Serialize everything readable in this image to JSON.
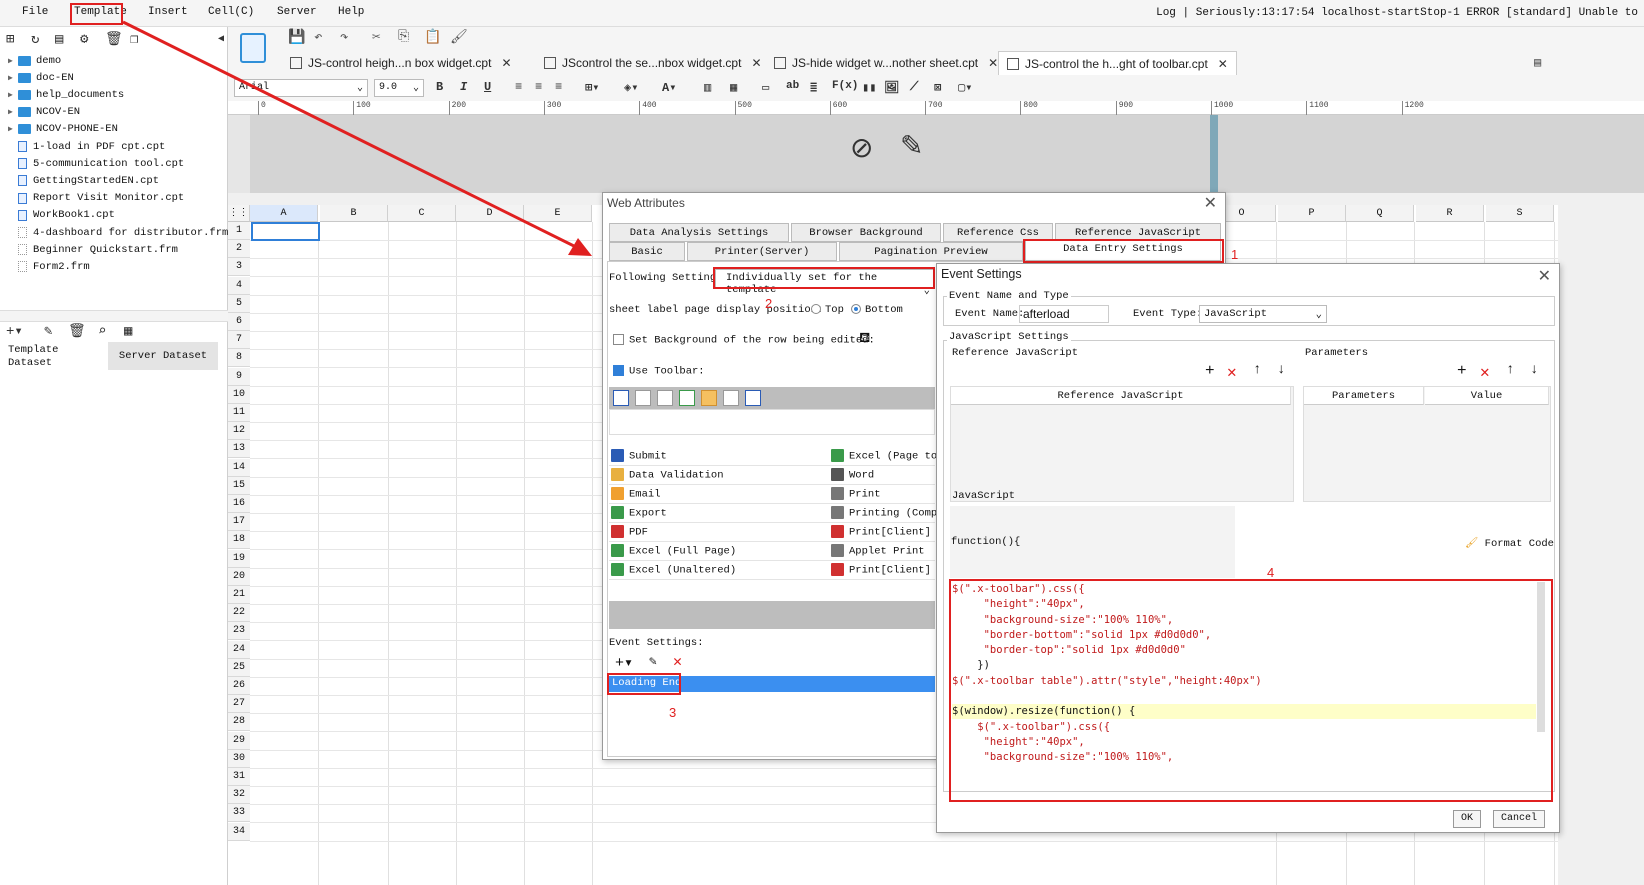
{
  "menu": [
    "File",
    "Template",
    "Insert",
    "Cell(C)",
    "Server",
    "Help"
  ],
  "log": "Log | Seriously:13:17:54 localhost-startStop-1 ERROR [standard] Unable to",
  "tree": [
    {
      "label": "demo",
      "kind": "folder"
    },
    {
      "label": "doc-EN",
      "kind": "folder"
    },
    {
      "label": "help_documents",
      "kind": "folder"
    },
    {
      "label": "NCOV-EN",
      "kind": "folder"
    },
    {
      "label": "NCOV-PHONE-EN",
      "kind": "folder"
    },
    {
      "label": "1-load in PDF cpt.cpt",
      "kind": "cpt"
    },
    {
      "label": "5-communication tool.cpt",
      "kind": "cpt"
    },
    {
      "label": "GettingStartedEN.cpt",
      "kind": "cpt"
    },
    {
      "label": "Report Visit Monitor.cpt",
      "kind": "cpt"
    },
    {
      "label": "WorkBook1.cpt",
      "kind": "cpt"
    },
    {
      "label": "4-dashboard for distributor.frm",
      "kind": "frm"
    },
    {
      "label": "Beginner Quickstart.frm",
      "kind": "frm"
    },
    {
      "label": "Form2.frm",
      "kind": "frm"
    }
  ],
  "dataset_tabs": [
    "Template Dataset",
    "Server Dataset"
  ],
  "doc_tabs": [
    "JS-control heigh...n box widget.cpt",
    "JScontrol the se...nbox widget.cpt",
    "JS-hide widget w...nother sheet.cpt",
    "JS-control the h...ght of toolbar.cpt"
  ],
  "font_name": "Arial",
  "font_size": "9.0",
  "ruler": [
    "0",
    "100",
    "200",
    "300",
    "400",
    "500",
    "600",
    "700",
    "800",
    "900",
    "1000",
    "1100",
    "1200"
  ],
  "columns": [
    "A",
    "B",
    "C",
    "D",
    "E",
    "O",
    "P",
    "Q",
    "R",
    "S"
  ],
  "rows": [
    "1",
    "2",
    "3",
    "4",
    "5",
    "6",
    "7",
    "8",
    "9",
    "10",
    "11",
    "12",
    "13",
    "14",
    "15",
    "16",
    "17",
    "18",
    "19",
    "20",
    "21",
    "22",
    "23",
    "24",
    "25",
    "26",
    "27",
    "28",
    "29",
    "30",
    "31",
    "32",
    "33",
    "34"
  ],
  "web_attr": {
    "title": "Web Attributes",
    "tabs_row1": [
      "Data Analysis Settings",
      "Browser Background",
      "Reference Css",
      "Reference JavaScript"
    ],
    "tabs_row2": [
      "Basic",
      "Printer(Server)",
      "Pagination Preview",
      "Data Entry Settings"
    ],
    "following_label": "Following Settings:",
    "following_value": "Individually set for the template",
    "sheet_label": "sheet label page display position:",
    "pos_top": "Top",
    "pos_bottom": "Bottom",
    "bg_row": "Set Background of the row being edited:",
    "use_toolbar": "Use Toolbar:",
    "buttons_left": [
      "Submit",
      "Data Validation",
      "Email",
      "Export",
      "PDF",
      "Excel (Full Page)",
      "Excel (Unaltered)"
    ],
    "buttons_right": [
      "Excel (Page to",
      "Word",
      "Print",
      "Printing (Compa",
      "Print[Client]",
      "Applet Print",
      "Print[Client]"
    ],
    "event_settings": "Event Settings:",
    "event_item": "Loading End"
  },
  "event_dlg": {
    "title": "Event Settings",
    "name_type": "Event Name and Type",
    "event_name_label": "Event Name:",
    "event_name_value": "afterload",
    "event_type_label": "Event Type:",
    "event_type_value": "JavaScript",
    "js_settings": "JavaScript Settings",
    "ref_js": "Reference JavaScript",
    "params": "Parameters",
    "col_ref_js": "Reference JavaScript",
    "col_params": "Parameters",
    "col_value": "Value",
    "javascript": "JavaScript",
    "function_head": "function(){",
    "format_code": "Format Code",
    "ok": "OK",
    "cancel": "Cancel",
    "code": [
      "$(\".x-toolbar\").css({",
      "     \"height\":\"40px\",",
      "     \"background-size\":\"100% 110%\",",
      "     \"border-bottom\":\"solid 1px #d0d0d0\",",
      "     \"border-top\":\"solid 1px #d0d0d0\"",
      "    })",
      "$(\".x-toolbar table\").attr(\"style\",\"height:40px\")",
      "",
      "$(window).resize(function() {",
      "    $(\".x-toolbar\").css({",
      "     \"height\":\"40px\",",
      "     \"background-size\":\"100% 110%\","
    ]
  },
  "annotations": [
    "1",
    "2",
    "3",
    "4"
  ],
  "colors": {
    "red": "#e02020",
    "blue": "#2f7fd8",
    "selected_row": "#3b8ff0"
  }
}
